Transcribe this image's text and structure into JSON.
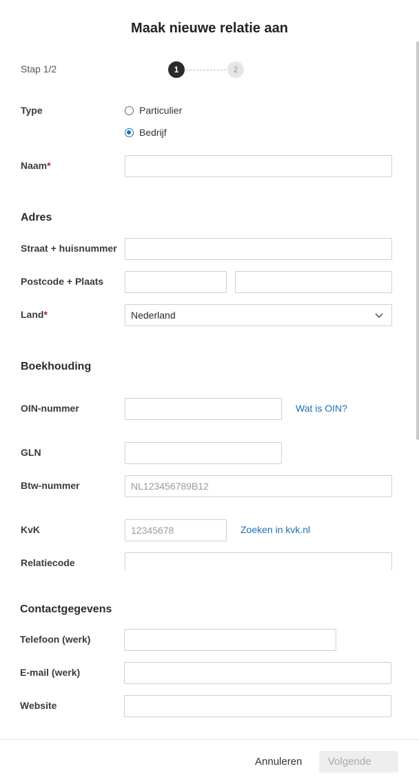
{
  "modal": {
    "title": "Maak nieuwe relatie aan"
  },
  "stepper": {
    "label": "Stap 1/2",
    "steps": [
      "1",
      "2"
    ],
    "current": 1
  },
  "type": {
    "label": "Type",
    "options": [
      {
        "label": "Particulier",
        "checked": false
      },
      {
        "label": "Bedrijf",
        "checked": true
      }
    ]
  },
  "naam": {
    "label": "Naam",
    "required_mark": "*",
    "value": ""
  },
  "adres": {
    "section_title": "Adres",
    "straat": {
      "label": "Straat + huisnummer",
      "value": ""
    },
    "postcode_plaats": {
      "label": "Postcode + Plaats",
      "postcode": "",
      "plaats": ""
    },
    "land": {
      "label": "Land",
      "required_mark": "*",
      "value": "Nederland"
    }
  },
  "boekhouding": {
    "section_title": "Boekhouding",
    "oin": {
      "label": "OIN-nummer",
      "value": "",
      "help_link": "Wat is OIN?"
    },
    "gln": {
      "label": "GLN",
      "value": ""
    },
    "btw": {
      "label": "Btw-nummer",
      "placeholder": "NL123456789B12"
    },
    "kvk": {
      "label": "KvK",
      "placeholder": "12345678",
      "search_link": "Zoeken in kvk.nl"
    },
    "relatiecode": {
      "label": "Relatiecode",
      "value": ""
    }
  },
  "contact": {
    "section_title": "Contactgegevens",
    "telefoon": {
      "label": "Telefoon (werk)",
      "value": ""
    },
    "email": {
      "label": "E-mail (werk)",
      "value": ""
    },
    "website": {
      "label": "Website",
      "value": ""
    }
  },
  "footer": {
    "cancel_label": "Annuleren",
    "next_label": "Volgende"
  },
  "colors": {
    "accent": "#1a6fb5",
    "required": "#c1121f",
    "step_active": "#2b2b2b",
    "step_inactive": "#e6e6e6"
  }
}
